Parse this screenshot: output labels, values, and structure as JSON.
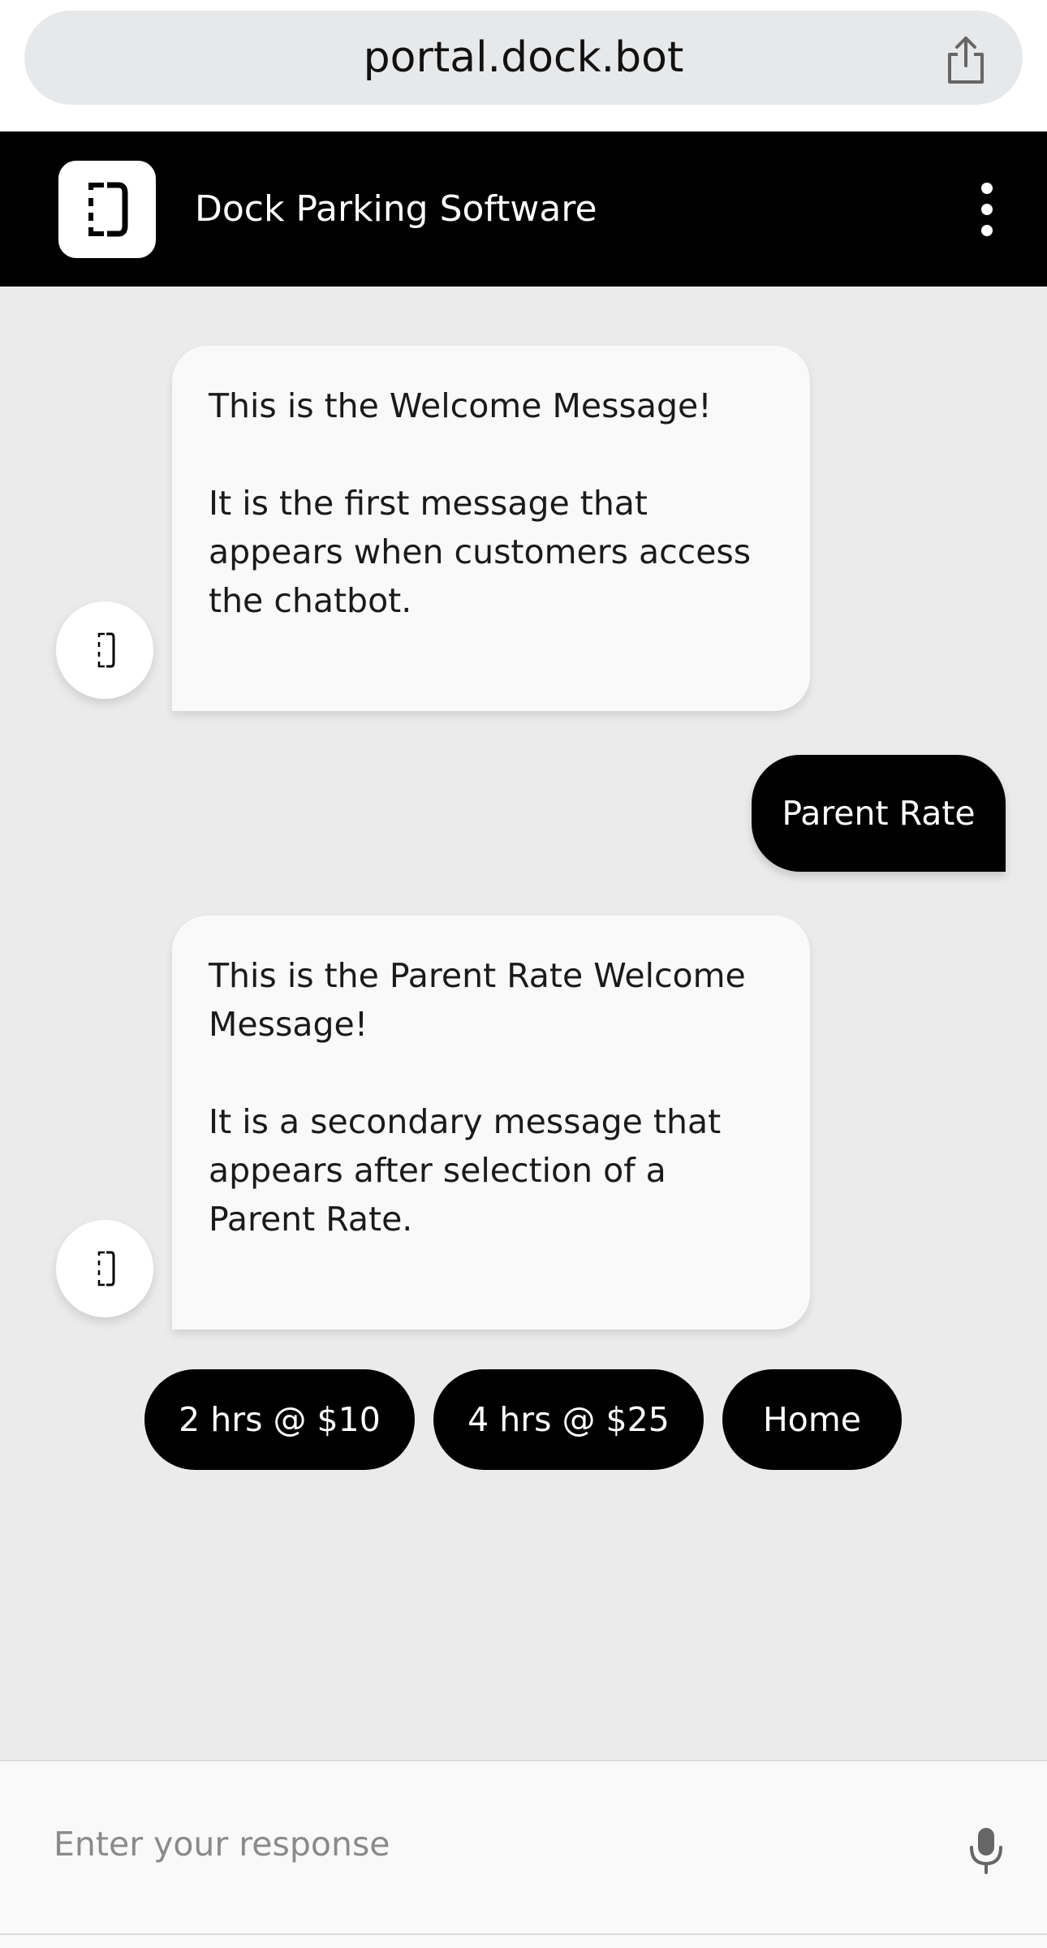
{
  "browser": {
    "url": "portal.dock.bot",
    "share_icon": "share-icon"
  },
  "header": {
    "title": "Dock Parking Software",
    "logo_icon": "dock-logo-icon",
    "menu_icon": "kebab-menu-icon"
  },
  "messages": [
    {
      "sender": "bot",
      "paragraphs": [
        "This is the Welcome Message!",
        "It is the first message that appears when customers access the chatbot."
      ]
    },
    {
      "sender": "user",
      "text": "Parent Rate"
    },
    {
      "sender": "bot",
      "paragraphs": [
        "This is the Parent Rate Welcome Message!",
        "It is a secondary message that appears after selection of a Parent Rate."
      ]
    }
  ],
  "quick_replies": [
    "2 hrs @ $10",
    "4 hrs @ $25",
    "Home"
  ],
  "composer": {
    "placeholder": "Enter your response",
    "mic_icon": "microphone-icon"
  },
  "colors": {
    "header_bg": "#000000",
    "chat_bg": "#ebebeb",
    "bot_bubble": "#f9f9f9",
    "user_bubble": "#000000"
  }
}
